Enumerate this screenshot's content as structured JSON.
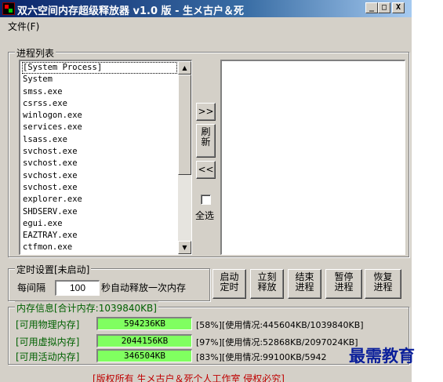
{
  "window": {
    "title": "双六空间内存超级释放器 v1.0 版 - 生メ古户＆死",
    "controls": {
      "minimize": "_",
      "maximize": "□",
      "close": "X"
    }
  },
  "menu": {
    "file": "文件(F)"
  },
  "process_list": {
    "title": "进程列表",
    "items": [
      "[System Process]",
      "System",
      "smss.exe",
      "csrss.exe",
      "winlogon.exe",
      "services.exe",
      "lsass.exe",
      "svchost.exe",
      "svchost.exe",
      "svchost.exe",
      "svchost.exe",
      "explorer.exe",
      "SHDSERV.exe",
      "egui.exe",
      "EAZTRAY.exe",
      "ctfmon.exe"
    ]
  },
  "actions": {
    "move_right": ">>",
    "refresh": "刷新",
    "move_left": "<<",
    "select_all": "全选"
  },
  "timer": {
    "title": "定时设置[未启动]",
    "prefix": "每间隔",
    "interval": "100",
    "suffix": "秒自动释放一次内存",
    "buttons": {
      "start_timer": "启动定时",
      "release_now": "立刻释放",
      "kill_process": "结束进程",
      "pause_process": "暂停进程",
      "resume_process": "恢复进程"
    }
  },
  "memory": {
    "title": "内存信息[合计内存:1039840KB]",
    "rows": [
      {
        "label": "[可用物理内存]",
        "value": "594236KB",
        "info": "[58%][使用情况:445604KB/1039840KB]"
      },
      {
        "label": "[可用虚拟内存]",
        "value": "2044156KB",
        "info": "[97%][使用情况:52868KB/2097024KB]"
      },
      {
        "label": "[可用活动内存]",
        "value": "346504KB",
        "info": "[83%][使用情况:99100KB/5942"
      }
    ],
    "value_color": "#80ff60"
  },
  "footer": "[版权所有 生メ古户＆死个人工作室 侵权必究]",
  "watermark": "最需教育"
}
